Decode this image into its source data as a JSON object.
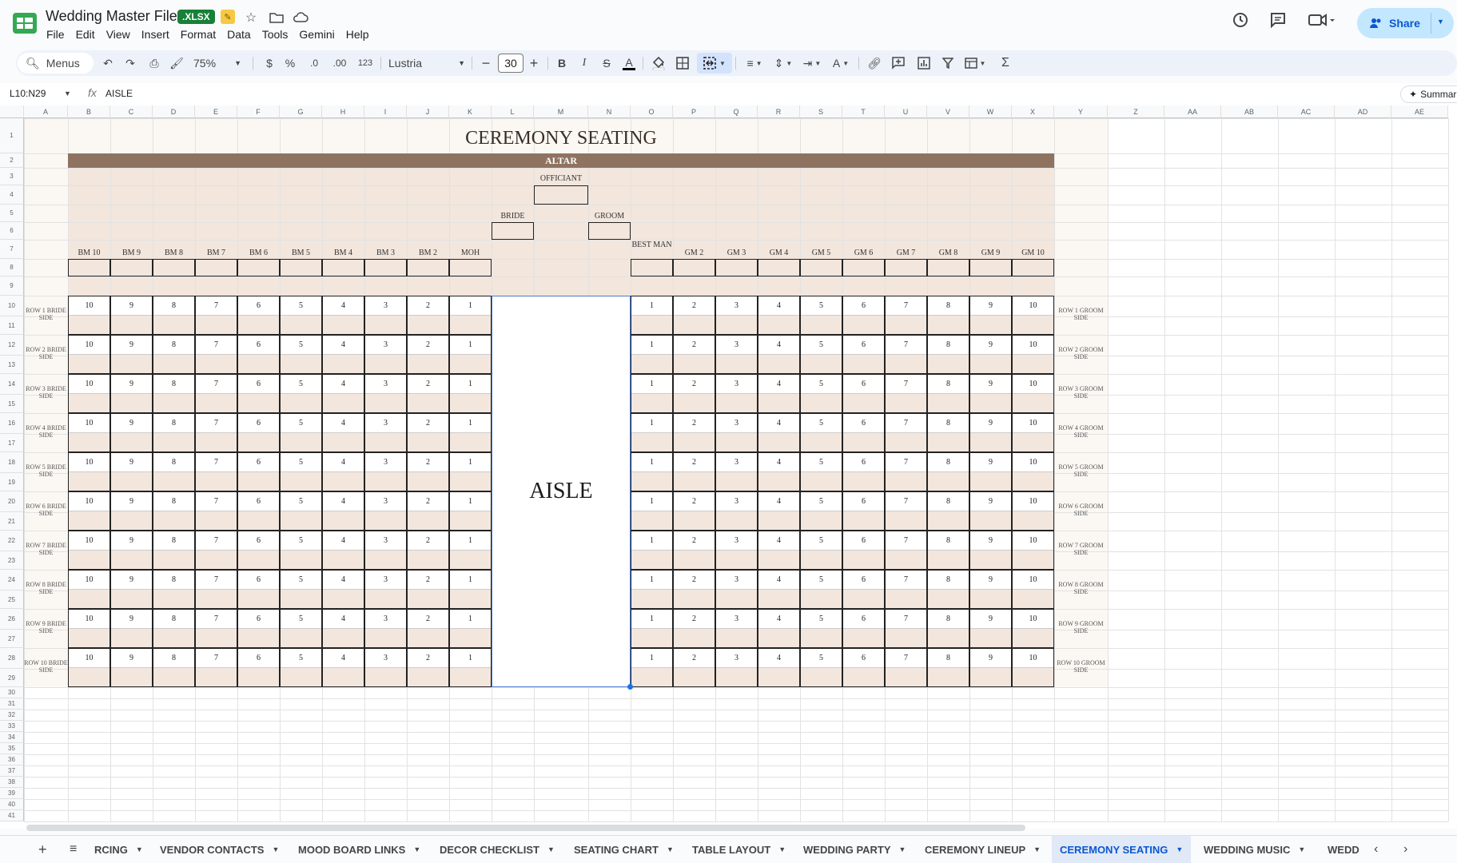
{
  "app": {
    "title": "Wedding Master File",
    "badge": ".XLSX",
    "menu": [
      "File",
      "Edit",
      "View",
      "Insert",
      "Format",
      "Data",
      "Tools",
      "Gemini",
      "Help"
    ],
    "share_label": "Share"
  },
  "toolbar": {
    "search_label": "Menus",
    "zoom": "75%",
    "currency": "$",
    "percent": "%",
    "dec_less": ".0",
    "dec_more": ".00",
    "number_format": "123",
    "font": "Lustria",
    "font_size": "30"
  },
  "formula": {
    "name_box": "L10:N29",
    "fx": "fx",
    "value": "AISLE",
    "summarize": "Summarize"
  },
  "columns": [
    "A",
    "B",
    "C",
    "D",
    "E",
    "F",
    "G",
    "H",
    "I",
    "J",
    "K",
    "L",
    "M",
    "N",
    "O",
    "P",
    "Q",
    "R",
    "S",
    "T",
    "U",
    "V",
    "W",
    "X",
    "Y",
    "Z",
    "AA",
    "AB",
    "AC",
    "AD",
    "AE"
  ],
  "rows": [
    "1",
    "2",
    "3",
    "4",
    "5",
    "6",
    "7",
    "8",
    "9",
    "10",
    "11",
    "12",
    "13",
    "14",
    "15",
    "16",
    "17",
    "18",
    "19",
    "20",
    "21",
    "22",
    "23",
    "24",
    "25",
    "26",
    "27",
    "28",
    "29",
    "30",
    "31",
    "32",
    "33",
    "34",
    "35",
    "36",
    "37",
    "38",
    "39",
    "40",
    "41"
  ],
  "sheet": {
    "title": "CEREMONY SEATING",
    "altar": "ALTAR",
    "officiant": "OFFICIANT",
    "bride": "BRIDE",
    "groom": "GROOM",
    "aisle": "AISLE",
    "bride_party": [
      "BM 10",
      "BM 9",
      "BM 8",
      "BM 7",
      "BM 6",
      "BM 5",
      "BM 4",
      "BM 3",
      "BM 2",
      "MOH"
    ],
    "groom_party": [
      "BEST MAN",
      "GM 2",
      "GM 3",
      "GM 4",
      "GM 5",
      "GM 6",
      "GM 7",
      "GM 8",
      "GM 9",
      "GM 10"
    ],
    "bride_seat_numbers": [
      "10",
      "9",
      "8",
      "7",
      "6",
      "5",
      "4",
      "3",
      "2",
      "1"
    ],
    "groom_seat_numbers": [
      "1",
      "2",
      "3",
      "4",
      "5",
      "6",
      "7",
      "8",
      "9",
      "10"
    ],
    "bride_rows": [
      "ROW 1 BRIDE SIDE",
      "ROW 2 BRIDE SIDE",
      "ROW 3 BRIDE SIDE",
      "ROW 4 BRIDE SIDE",
      "ROW 5 BRIDE SIDE",
      "ROW 6 BRIDE SIDE",
      "ROW 7 BRIDE SIDE",
      "ROW 8 BRIDE SIDE",
      "ROW 9 BRIDE SIDE",
      "ROW 10 BRIDE SIDE"
    ],
    "groom_rows": [
      "ROW 1 GROOM SIDE",
      "ROW 2 GROOM SIDE",
      "ROW 3 GROOM SIDE",
      "ROW 4 GROOM SIDE",
      "ROW 5 GROOM SIDE",
      "ROW 6 GROOM SIDE",
      "ROW 7 GROOM SIDE",
      "ROW 8 GROOM SIDE",
      "ROW 9 GROOM SIDE",
      "ROW 10 GROOM SIDE"
    ]
  },
  "tabs": [
    "RCING",
    "VENDOR CONTACTS",
    "MOOD BOARD LINKS",
    "DECOR CHECKLIST",
    "SEATING CHART",
    "TABLE LAYOUT",
    "WEDDING PARTY",
    "CEREMONY LINEUP",
    "CEREMONY SEATING",
    "WEDDING MUSIC",
    "WEDD"
  ],
  "active_tab": "CEREMONY SEATING",
  "colors": {
    "accent": "#0b57d0",
    "altar": "#8f7361",
    "tan": "#f2e6dd",
    "cream": "#fbf8f3",
    "sheets_green": "#188038"
  }
}
